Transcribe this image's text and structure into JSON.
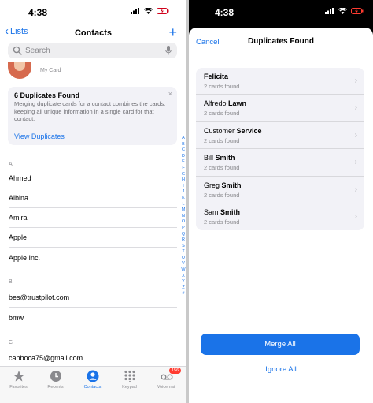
{
  "left": {
    "status": {
      "time": "4:38"
    },
    "nav": {
      "back_label": "Lists",
      "title": "Contacts",
      "add": "+"
    },
    "search": {
      "placeholder": "Search"
    },
    "my_card": {
      "label": "My Card"
    },
    "duplicates_card": {
      "title": "6 Duplicates Found",
      "description": "Merging duplicate cards for a contact combines the cards, keeping all unique information in a single card for that contact.",
      "action": "View Duplicates",
      "close": "×"
    },
    "sections": [
      {
        "letter": "A",
        "contacts": [
          "Ahmed",
          "Albina",
          "Amira",
          "Apple",
          "Apple Inc."
        ]
      },
      {
        "letter": "B",
        "contacts": [
          "bes@trustpilot.com",
          "bmw"
        ]
      },
      {
        "letter": "C",
        "contacts": [
          "cahboca75@gmail.com"
        ]
      }
    ],
    "index_letters": [
      "A",
      "B",
      "C",
      "D",
      "E",
      "F",
      "G",
      "H",
      "I",
      "J",
      "K",
      "L",
      "M",
      "N",
      "O",
      "P",
      "Q",
      "R",
      "S",
      "T",
      "U",
      "V",
      "W",
      "X",
      "Y",
      "Z",
      "#"
    ],
    "tabs": [
      {
        "label": "Favorites",
        "icon": "star-icon",
        "active": false
      },
      {
        "label": "Recents",
        "icon": "clock-icon",
        "active": false
      },
      {
        "label": "Contacts",
        "icon": "person-icon",
        "active": true
      },
      {
        "label": "Keypad",
        "icon": "keypad-icon",
        "active": false
      },
      {
        "label": "Voicemail",
        "icon": "voicemail-icon",
        "active": false,
        "badge": "156"
      }
    ]
  },
  "right": {
    "status": {
      "time": "4:38"
    },
    "sheet": {
      "cancel_label": "Cancel",
      "title": "Duplicates Found"
    },
    "duplicates": [
      {
        "first": "Felicita",
        "last": "",
        "sub": "2 cards found"
      },
      {
        "first": "Alfredo",
        "last": "Lawn",
        "sub": "2 cards found"
      },
      {
        "first": "Customer",
        "last": "Service",
        "sub": "2 cards found"
      },
      {
        "first": "Bill",
        "last": "Smith",
        "sub": "2 cards found"
      },
      {
        "first": "Greg",
        "last": "Smith",
        "sub": "2 cards found"
      },
      {
        "first": "Sam",
        "last": "Smith",
        "sub": "2 cards found"
      }
    ],
    "merge_all": "Merge All",
    "ignore_all": "Ignore All"
  },
  "colors": {
    "accent": "#1a73e8",
    "badge": "#ff3b30",
    "card_bg": "#f2f2f7"
  }
}
